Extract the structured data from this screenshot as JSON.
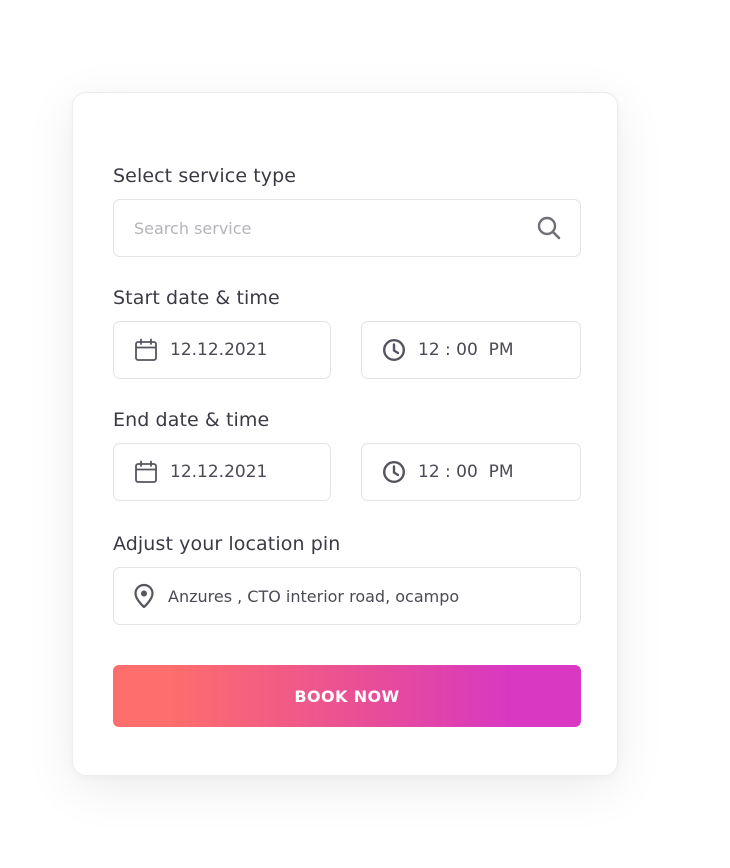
{
  "form": {
    "service_label": "Select service type",
    "search_placeholder": "Search service",
    "start_label": "Start date & time",
    "start_date": "12.12.2021",
    "start_time": "12 : 00  PM",
    "end_label": "End date & time",
    "end_date": "12.12.2021",
    "end_time": "12 : 00  PM",
    "location_label": "Adjust your location pin",
    "location_value": "Anzures , CTO interior road, ocampo",
    "book_button": "BOOK NOW"
  },
  "icons": {
    "search": "search-icon",
    "calendar": "calendar-icon",
    "clock": "clock-icon",
    "location": "location-pin-icon"
  },
  "colors": {
    "button_gradient_start": "#fd6e6c",
    "button_gradient_end": "#d838c2",
    "icon": "#55555f",
    "border": "#e3e3e6"
  }
}
